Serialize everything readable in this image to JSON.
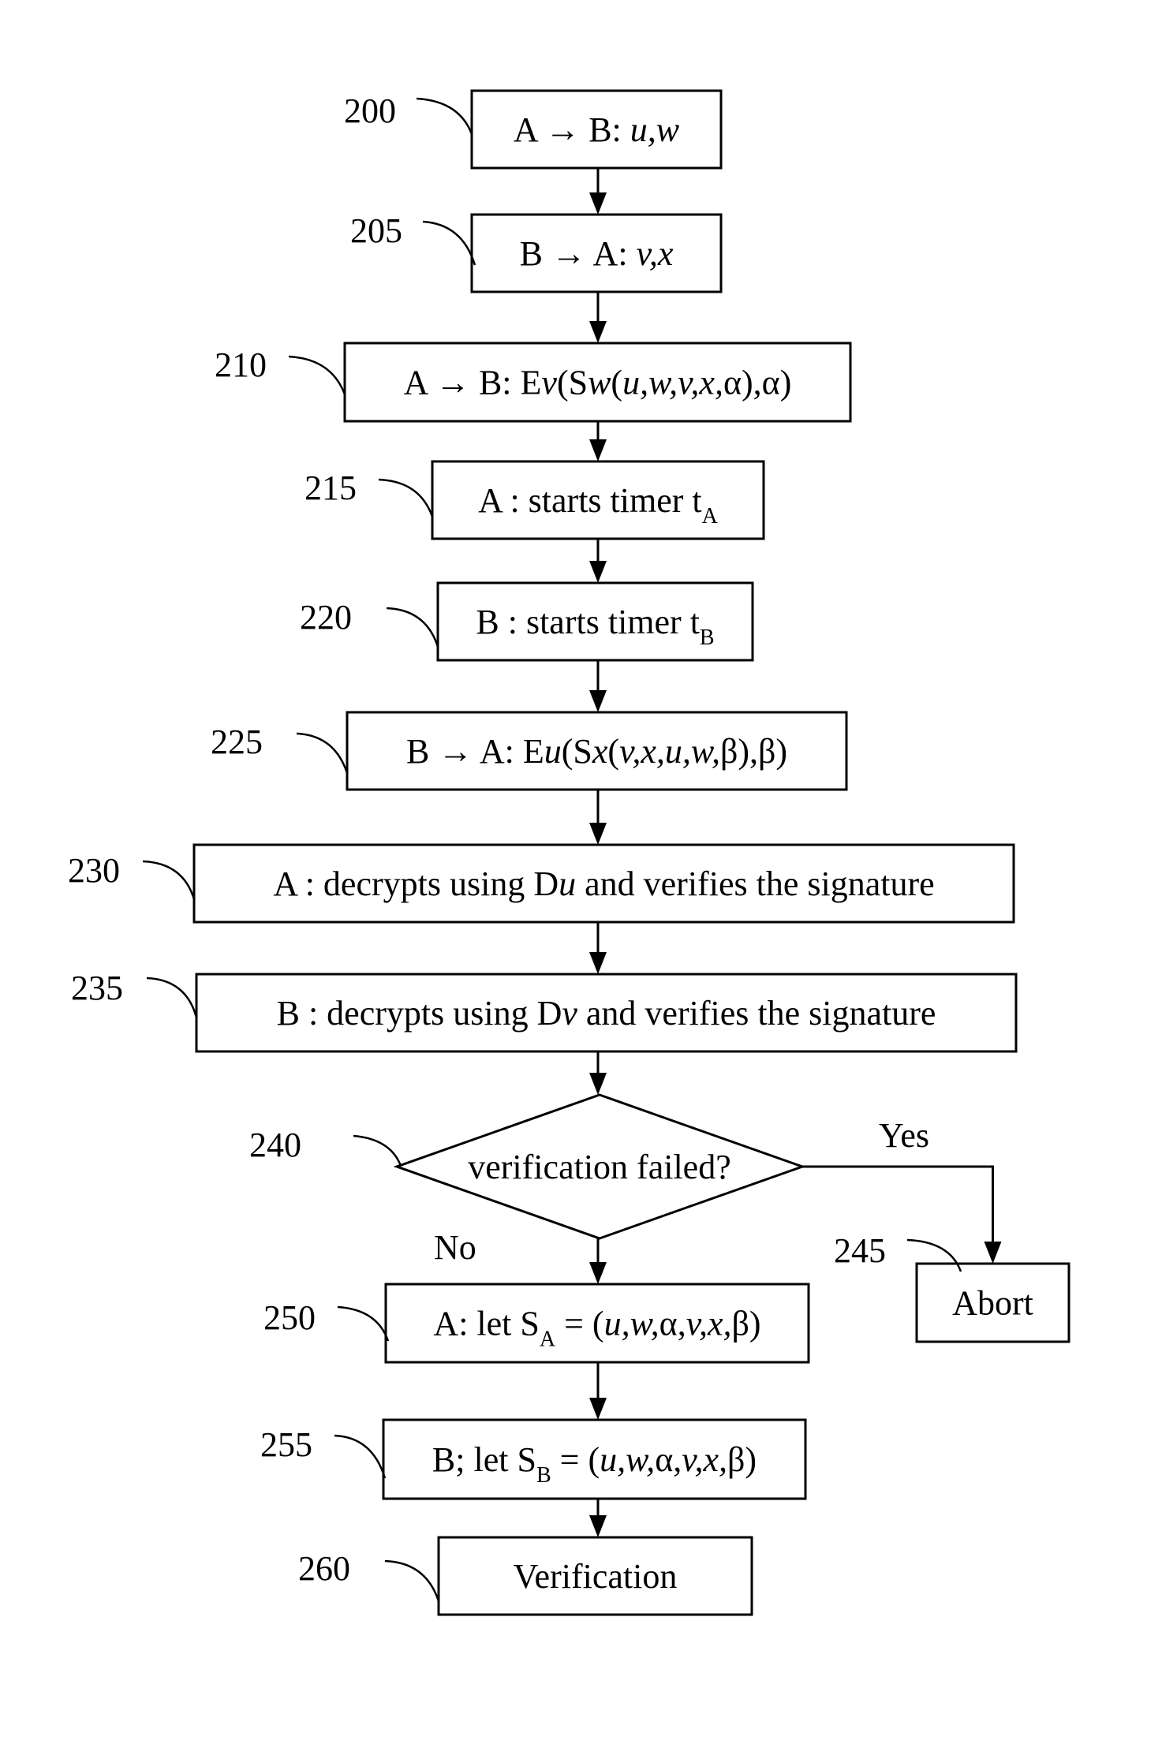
{
  "figure": {
    "type": "flowchart",
    "steps": [
      {
        "ref": "200",
        "shape": "box",
        "parts": [
          {
            "t": "A → B: "
          },
          {
            "t": "u,w",
            "i": true
          }
        ]
      },
      {
        "ref": "205",
        "shape": "box",
        "parts": [
          {
            "t": "B → A: "
          },
          {
            "t": "v,x",
            "i": true
          }
        ]
      },
      {
        "ref": "210",
        "shape": "box",
        "parts": [
          {
            "t": "A → B: E"
          },
          {
            "t": "v",
            "i": true
          },
          {
            "t": "(S"
          },
          {
            "t": "w",
            "i": true
          },
          {
            "t": "("
          },
          {
            "t": "u,w,v,x,",
            "i": true
          },
          {
            "t": "α),α)"
          }
        ]
      },
      {
        "ref": "215",
        "shape": "box",
        "parts": [
          {
            "t": "A : starts timer t"
          },
          {
            "t": "A",
            "sub": true
          }
        ]
      },
      {
        "ref": "220",
        "shape": "box",
        "parts": [
          {
            "t": "B : starts timer t"
          },
          {
            "t": "B",
            "sub": true
          }
        ]
      },
      {
        "ref": "225",
        "shape": "box",
        "parts": [
          {
            "t": "B → A: E"
          },
          {
            "t": "u",
            "i": true
          },
          {
            "t": "(S"
          },
          {
            "t": "x",
            "i": true
          },
          {
            "t": "("
          },
          {
            "t": "v,x,u,w,",
            "i": true
          },
          {
            "t": "β),β)"
          }
        ]
      },
      {
        "ref": "230",
        "shape": "box",
        "parts": [
          {
            "t": "A : decrypts using D"
          },
          {
            "t": "u",
            "i": true
          },
          {
            "t": " and verifies the signature"
          }
        ]
      },
      {
        "ref": "235",
        "shape": "box",
        "parts": [
          {
            "t": "B : decrypts using D"
          },
          {
            "t": "v",
            "i": true
          },
          {
            "t": " and verifies the signature"
          }
        ]
      },
      {
        "ref": "240",
        "shape": "diamond",
        "parts": [
          {
            "t": "verification failed?"
          }
        ]
      },
      {
        "ref": "245",
        "shape": "box",
        "parts": [
          {
            "t": "Abort"
          }
        ]
      },
      {
        "ref": "250",
        "shape": "box",
        "parts": [
          {
            "t": "A: let S"
          },
          {
            "t": "A",
            "sub": true
          },
          {
            "t": " = ("
          },
          {
            "t": "u,w,",
            "i": true
          },
          {
            "t": "α,"
          },
          {
            "t": "v,x,",
            "i": true
          },
          {
            "t": "β)"
          }
        ]
      },
      {
        "ref": "255",
        "shape": "box",
        "parts": [
          {
            "t": "B; let S"
          },
          {
            "t": "B",
            "sub": true
          },
          {
            "t": " = ("
          },
          {
            "t": "u,w,",
            "i": true
          },
          {
            "t": "α,"
          },
          {
            "t": "v,x,",
            "i": true
          },
          {
            "t": "β)"
          }
        ]
      },
      {
        "ref": "260",
        "shape": "box",
        "parts": [
          {
            "t": "Verification"
          }
        ]
      }
    ],
    "branch_labels": {
      "yes": "Yes",
      "no": "No"
    },
    "edges": [
      [
        "200",
        "205"
      ],
      [
        "205",
        "210"
      ],
      [
        "210",
        "215"
      ],
      [
        "215",
        "220"
      ],
      [
        "220",
        "225"
      ],
      [
        "225",
        "230"
      ],
      [
        "230",
        "235"
      ],
      [
        "235",
        "240"
      ],
      [
        "240",
        "245",
        "Yes"
      ],
      [
        "240",
        "250",
        "No"
      ],
      [
        "250",
        "255"
      ],
      [
        "255",
        "260"
      ]
    ]
  }
}
